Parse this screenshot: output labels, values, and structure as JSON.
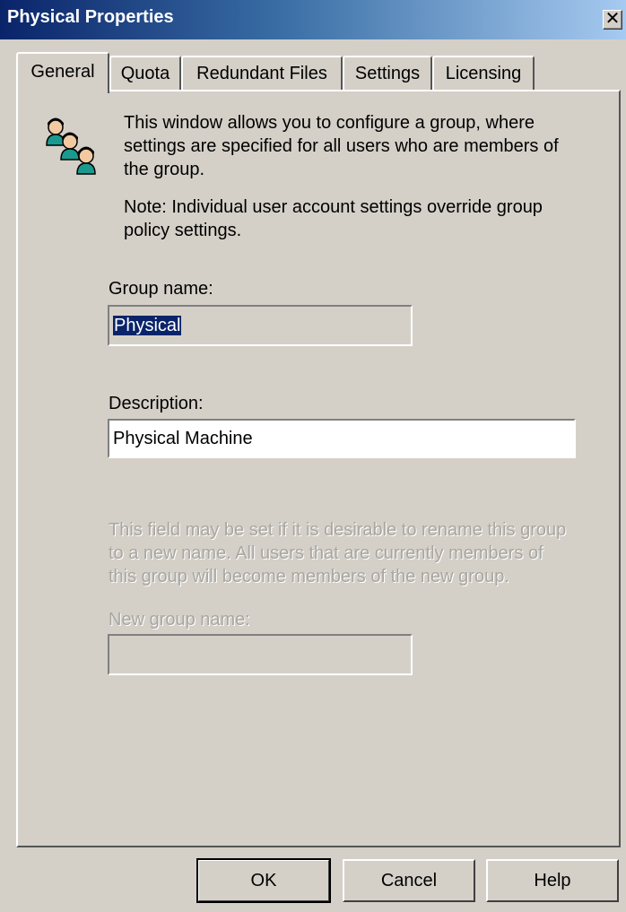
{
  "window": {
    "title": "Physical Properties",
    "close_glyph": "✕"
  },
  "tabs": [
    {
      "label": "General",
      "active": true
    },
    {
      "label": "Quota"
    },
    {
      "label": "Redundant Files"
    },
    {
      "label": "Settings"
    },
    {
      "label": "Licensing"
    }
  ],
  "general": {
    "icon": "users-group-icon",
    "intro_lines": [
      "This window allows you to configure a group, where",
      "settings are specified for all users who are members of",
      "the group."
    ],
    "note_lines": [
      "Note: Individual user account settings override group",
      "policy settings."
    ],
    "group_name_label": "Group name:",
    "group_name_value": "Physical",
    "description_label": "Description:",
    "description_value": "Physical Machine",
    "rename_help_lines": [
      "This field may be set if it is desirable to rename this group",
      "to a new name. All users that are currently members of",
      "this group will become members of the new group."
    ],
    "new_group_name_label": "New group name:",
    "new_group_name_value": ""
  },
  "buttons": {
    "ok": "OK",
    "cancel": "Cancel",
    "help": "Help"
  },
  "colors": {
    "title_bar_start": "#0a246a",
    "title_bar_end": "#a6caf0",
    "dialog_bg": "#d4d0c8",
    "selection": "#0a246a"
  }
}
